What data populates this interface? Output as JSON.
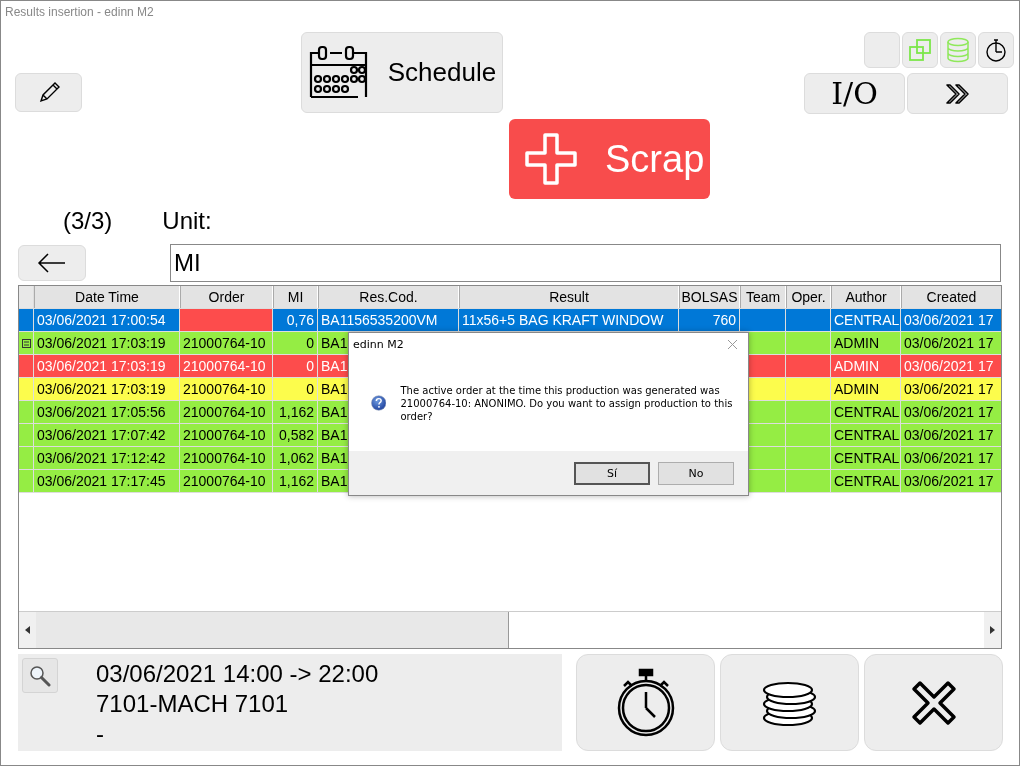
{
  "window": {
    "title": "Results insertion - edinn M2"
  },
  "toolbar": {
    "schedule": "Schedule",
    "io": "I/O",
    "scrap": "Scrap"
  },
  "counter": "(3/3)",
  "unit": {
    "label": "Unit:",
    "value": "MI"
  },
  "table": {
    "columns": [
      "Date Time",
      "Order",
      "MI",
      "Res.Cod.",
      "Result",
      "BOLSAS",
      "Team",
      "Oper.",
      "Author",
      "Created"
    ],
    "rows": [
      {
        "selected": true,
        "marker": false,
        "order_cell": {
          "color": "#fd4c4c"
        },
        "cells": [
          "03/06/2021 17:00:54",
          null,
          "0,76",
          "BA1156535200VM",
          "11x56+5 BAG KRAFT WINDOW",
          "760",
          null,
          null,
          "CENTRAL",
          "03/06/2021 17"
        ]
      },
      {
        "selected": false,
        "marker": true,
        "color": "#95ed44",
        "cells": [
          "03/06/2021 17:03:19",
          "21000764-10",
          "0",
          "BA1",
          null,
          null,
          null,
          null,
          "ADMIN",
          "03/06/2021 17"
        ]
      },
      {
        "selected": false,
        "marker": false,
        "color": "#fd4c4c",
        "cells": [
          "03/06/2021 17:03:19",
          "21000764-10",
          "0",
          "BA1",
          null,
          null,
          null,
          null,
          "ADMIN",
          "03/06/2021 17"
        ]
      },
      {
        "selected": false,
        "marker": false,
        "color": "#fcfc4c",
        "cells": [
          "03/06/2021 17:03:19",
          "21000764-10",
          "0",
          "BA1",
          null,
          null,
          null,
          null,
          "ADMIN",
          "03/06/2021 17"
        ]
      },
      {
        "selected": false,
        "marker": false,
        "color": "#95ed44",
        "cells": [
          "03/06/2021 17:05:56",
          "21000764-10",
          "1,162",
          "BA1",
          null,
          null,
          null,
          null,
          "CENTRAL",
          "03/06/2021 17"
        ]
      },
      {
        "selected": false,
        "marker": false,
        "color": "#95ed44",
        "cells": [
          "03/06/2021 17:07:42",
          "21000764-10",
          "0,582",
          "BA1",
          null,
          null,
          null,
          null,
          "CENTRAL",
          "03/06/2021 17"
        ]
      },
      {
        "selected": false,
        "marker": false,
        "color": "#95ed44",
        "cells": [
          "03/06/2021 17:12:42",
          "21000764-10",
          "1,062",
          "BA1",
          null,
          null,
          null,
          null,
          "CENTRAL",
          "03/06/2021 17"
        ]
      },
      {
        "selected": false,
        "marker": false,
        "color": "#95ed44",
        "cells": [
          "03/06/2021 17:17:45",
          "21000764-10",
          "1,162",
          "BA1",
          null,
          null,
          null,
          null,
          "CENTRAL",
          "03/06/2021 17"
        ]
      }
    ]
  },
  "dialog": {
    "title": "edinn M2",
    "message": "The active order at the time this production was generated was 21000764-10: ANONIMO. Do you want to assign production to this order?",
    "buttons": [
      "Sí",
      "No"
    ]
  },
  "shift": {
    "lines": [
      "03/06/2021 14:00 -> 22:00",
      "7101-MACH 7101",
      "-"
    ]
  }
}
